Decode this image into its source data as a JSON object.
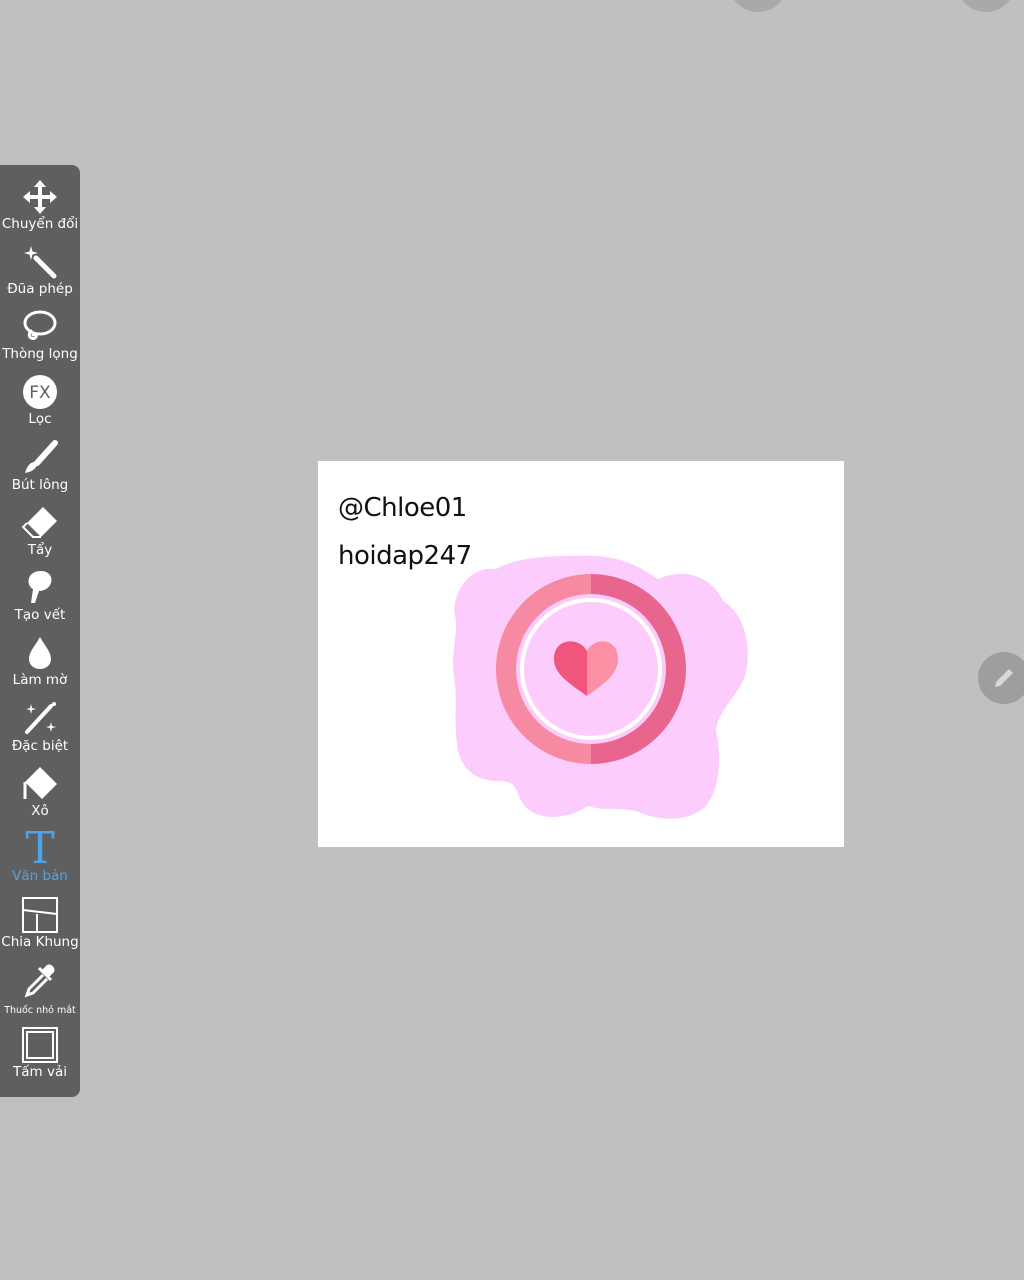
{
  "toolbar": {
    "tools": [
      {
        "label": "Chuyển đổi",
        "icon": "move-icon"
      },
      {
        "label": "Đũa phép",
        "icon": "magic-wand-icon"
      },
      {
        "label": "Thòng lọng",
        "icon": "lasso-icon"
      },
      {
        "label": "Lọc",
        "icon": "fx-filter-icon"
      },
      {
        "label": "Bút lông",
        "icon": "brush-icon"
      },
      {
        "label": "Tẩy",
        "icon": "eraser-icon"
      },
      {
        "label": "Tạo vết",
        "icon": "smudge-icon"
      },
      {
        "label": "Làm mờ",
        "icon": "blur-drop-icon"
      },
      {
        "label": "Đặc biệt",
        "icon": "sparkle-wand-icon"
      },
      {
        "label": "Xô",
        "icon": "bucket-icon"
      },
      {
        "label": "Văn bản",
        "icon": "text-icon",
        "active": true
      },
      {
        "label": "Chia Khung",
        "icon": "frame-divider-icon"
      },
      {
        "label": "Thuốc nhỏ mắt",
        "icon": "eyedropper-icon"
      },
      {
        "label": "Tấm vải",
        "icon": "canvas-icon"
      }
    ],
    "fx_glyph": "FX",
    "text_glyph": "T"
  },
  "canvas": {
    "line1": "@Chloe01",
    "line2": "hoidap247"
  },
  "colors": {
    "background": "#c0c0c0",
    "toolbar": "#5f5f5f",
    "active_tool": "#4fa3e6",
    "blob": "#fcccfc",
    "ring_light": "#f78aa3",
    "ring_dark": "#e8658e",
    "heart_dark": "#f0557e",
    "heart_light": "#fb8fa3"
  },
  "edit_button_icon": "pencil-icon"
}
